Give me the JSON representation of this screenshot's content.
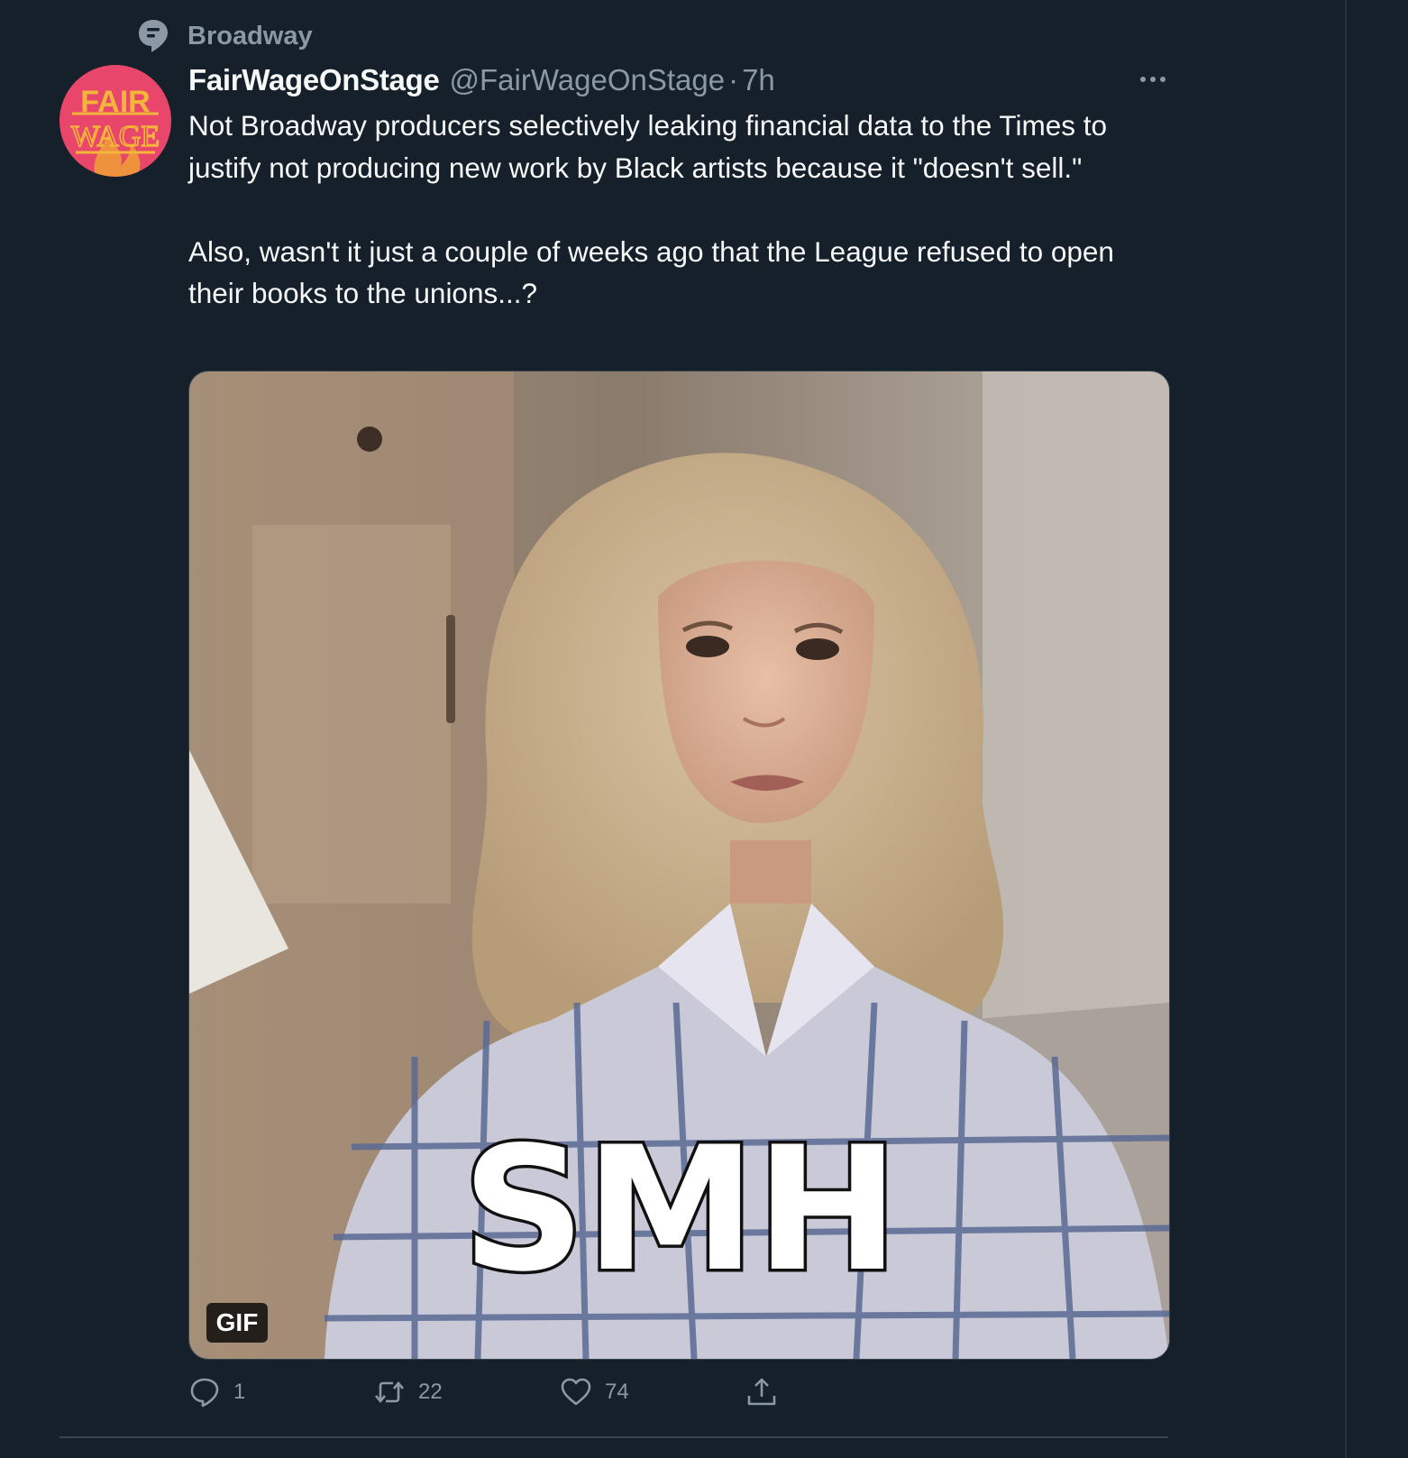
{
  "topic": {
    "label": "Broadway",
    "icon": "topic-bubble-icon"
  },
  "author": {
    "name": "FairWageOnStage",
    "handle": "@FairWageOnStage",
    "dot": "·",
    "time": "7h",
    "avatar": {
      "text_line1": "FAIR",
      "text_line2": "WAGE",
      "bg_color": "#e8476b",
      "text_color": "#f4b63a"
    }
  },
  "tweet": {
    "text": "Not Broadway producers selectively leaking financial data to the Times to justify not producing new work by Black artists because it \"doesn't sell.\"\n\nAlso, wasn't it just a couple of weeks ago that the League refused to open their books to the unions...?",
    "media": {
      "type": "gif",
      "caption": "SMH",
      "badge": "GIF"
    }
  },
  "actions": {
    "reply": {
      "icon": "reply-icon",
      "count": "1"
    },
    "retweet": {
      "icon": "retweet-icon",
      "count": "22"
    },
    "like": {
      "icon": "heart-icon",
      "count": "74"
    },
    "share": {
      "icon": "share-icon"
    }
  },
  "colors": {
    "background": "#15202b",
    "text": "#f7f9f9",
    "muted": "#8b98a5",
    "border": "#38444d"
  }
}
